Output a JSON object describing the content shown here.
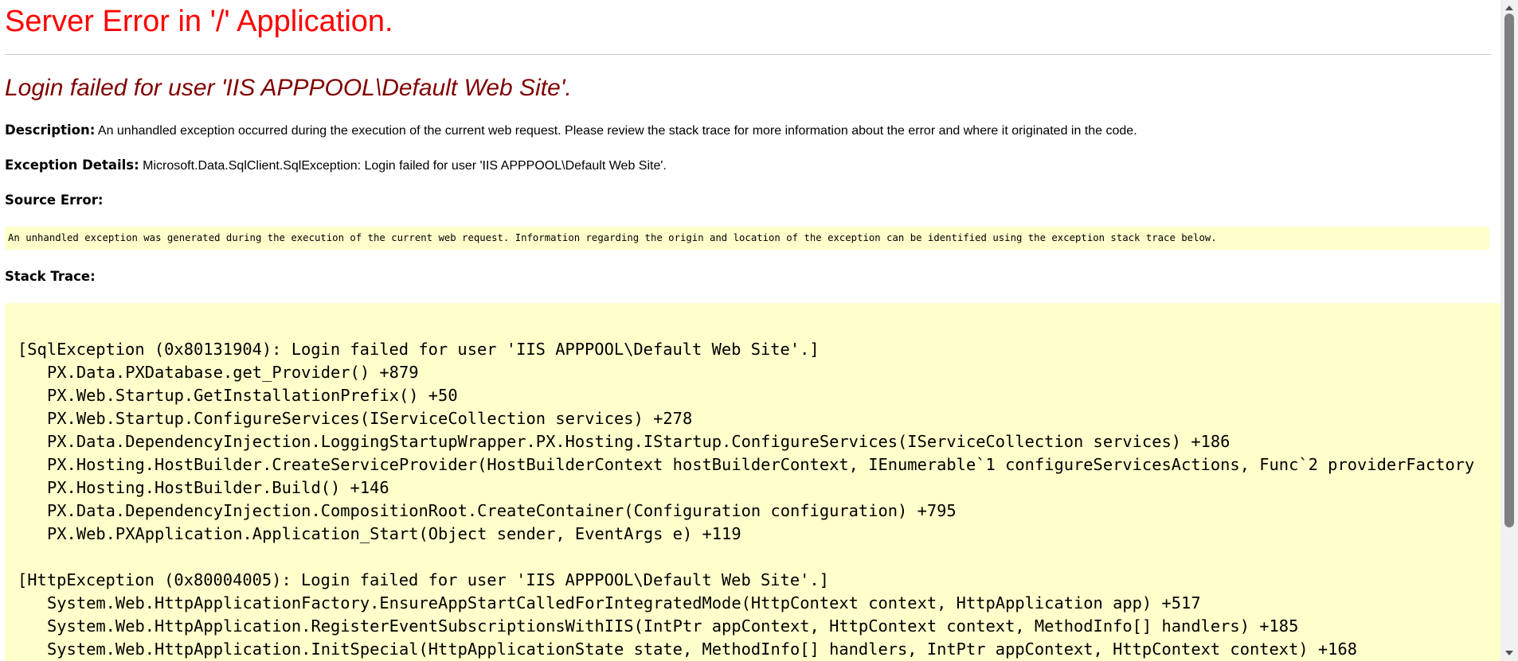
{
  "colors": {
    "title": "#ff0000",
    "subtitle": "#800000",
    "highlight_background": "#ffffcc",
    "rule": "#c8c8c8",
    "scrollbar_track": "#f1f1f1",
    "scrollbar_thumb": "#7f7f7f"
  },
  "page": {
    "title": "Server Error in '/' Application.",
    "subtitle": "Login failed for user 'IIS APPPOOL\\Default Web Site'."
  },
  "description": {
    "label": "Description:",
    "text": " An unhandled exception occurred during the execution of the current web request. Please review the stack trace for more information about the error and where it originated in the code."
  },
  "exception_details": {
    "label": "Exception Details:",
    "text": " Microsoft.Data.SqlClient.SqlException: Login failed for user 'IIS APPPOOL\\Default Web Site'."
  },
  "source_error": {
    "label": "Source Error:",
    "text": "An unhandled exception was generated during the execution of the current web request. Information regarding the origin and location of the exception can be identified using the exception stack trace below."
  },
  "stack_trace": {
    "label": "Stack Trace:",
    "blocks": [
      {
        "header": "[SqlException (0x80131904): Login failed for user 'IIS APPPOOL\\Default Web Site'.]",
        "frames": [
          "PX.Data.PXDatabase.get_Provider() +879",
          "PX.Web.Startup.GetInstallationPrefix() +50",
          "PX.Web.Startup.ConfigureServices(IServiceCollection services) +278",
          "PX.Data.DependencyInjection.LoggingStartupWrapper.PX.Hosting.IStartup.ConfigureServices(IServiceCollection services) +186",
          "PX.Hosting.HostBuilder.CreateServiceProvider(HostBuilderContext hostBuilderContext, IEnumerable`1 configureServicesActions, Func`2 providerFactory",
          "PX.Hosting.HostBuilder.Build() +146",
          "PX.Data.DependencyInjection.CompositionRoot.CreateContainer(Configuration configuration) +795",
          "PX.Web.PXApplication.Application_Start(Object sender, EventArgs e) +119"
        ]
      },
      {
        "header": "[HttpException (0x80004005): Login failed for user 'IIS APPPOOL\\Default Web Site'.]",
        "frames": [
          "System.Web.HttpApplicationFactory.EnsureAppStartCalledForIntegratedMode(HttpContext context, HttpApplication app) +517",
          "System.Web.HttpApplication.RegisterEventSubscriptionsWithIIS(IntPtr appContext, HttpContext context, MethodInfo[] handlers) +185",
          "System.Web.HttpApplication.InitSpecial(HttpApplicationState state, MethodInfo[] handlers, IntPtr appContext, HttpContext context) +168"
        ]
      }
    ]
  },
  "scrollbar": {
    "scroll_position": 0,
    "visible_fraction": 0.81
  }
}
